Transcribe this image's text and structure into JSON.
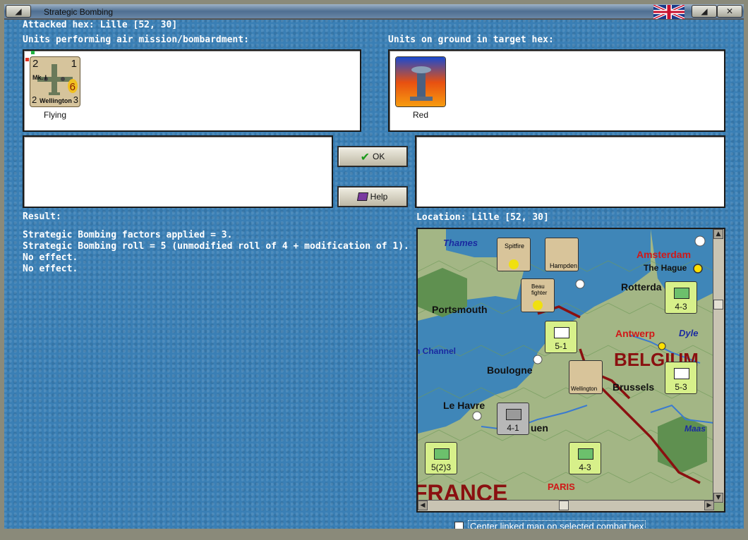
{
  "window": {
    "title": "Strategic Bombing"
  },
  "header": {
    "attacked_hex": "Attacked hex: Lille  [52, 30]"
  },
  "left_panel": {
    "heading": "Units performing air mission/bombardment:",
    "unit": {
      "name": "Wellington",
      "mark": "Mk. I",
      "top_left": "2",
      "top_right": "1",
      "bottom_left": "2",
      "bottom_right": "3",
      "factor": "6",
      "caption": "Flying"
    }
  },
  "right_panel": {
    "heading": "Units on ground in target hex:",
    "unit": {
      "caption": "Red"
    }
  },
  "buttons": {
    "ok": "OK",
    "help": "Help"
  },
  "result": {
    "heading": "Result:",
    "lines": [
      "Strategic Bombing factors applied = 3.",
      "Strategic Bombing roll = 5 (unmodified roll of 4 + modification of 1).",
      "No effect.",
      "No effect."
    ]
  },
  "location": {
    "heading": "Location:  Lille  [52, 30]"
  },
  "map": {
    "labels": {
      "thames": "Thames",
      "amsterdam": "Amsterdam",
      "the_hague": "The Hague",
      "rotterdam": "Rotterda",
      "portsmouth": "Portsmouth",
      "antwerp": "Antwerp",
      "dyle": "Dyle",
      "channel": "n Channel",
      "belgium": "BELGIUM",
      "boulogne": "Boulogne",
      "brussels": "Brussels",
      "le_havre": "Le Havre",
      "rouen": "uen",
      "maas": "Maas",
      "paris": "PARIS",
      "france": "FRANCE"
    },
    "counters": {
      "c1": "4-3",
      "c2": "5-1",
      "c3": "5-3",
      "c4": "4-1",
      "c5": "5(2)3",
      "c6": "4-3"
    },
    "aircards": {
      "spitfire": "Spitfire",
      "hampden": "Hampden",
      "beaufighter": "Beau fighter",
      "wellington": "Wellington"
    }
  },
  "footer": {
    "checkbox_label": "Center linked map on selected combat hex"
  },
  "colors": {
    "background": "#3a7fb5",
    "map_land": "#9ab07e",
    "map_sea": "#3f86b8",
    "counter": "#d7f08a",
    "city_red": "#d01818",
    "country_label": "#8a1010"
  }
}
